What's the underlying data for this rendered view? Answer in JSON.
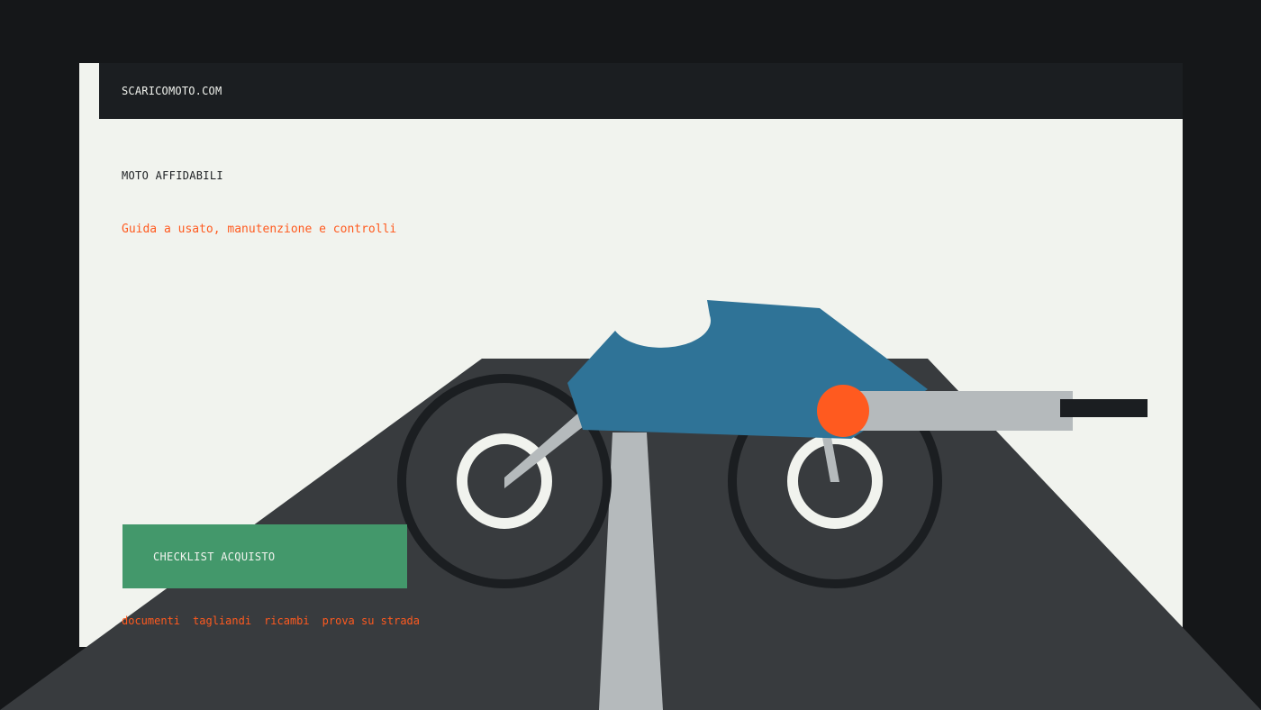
{
  "brand": "SCARICOMOTO.COM",
  "hero": {
    "eyebrow": "MOTO AFFIDABILI",
    "subtitle": "Guida a usato, manutenzione e controlli",
    "cta": "CHECKLIST ACQUISTO"
  },
  "links": [
    "documenti",
    "tagliandi",
    "ricambi",
    "prova su strada"
  ],
  "colors": {
    "background": "#151719",
    "panel": "#f1f3ee",
    "accent": "#ff5a1f",
    "cta": "#43986b",
    "tank": "#2f7397",
    "road": "#383b3e",
    "exhaust": "#b5babc"
  }
}
